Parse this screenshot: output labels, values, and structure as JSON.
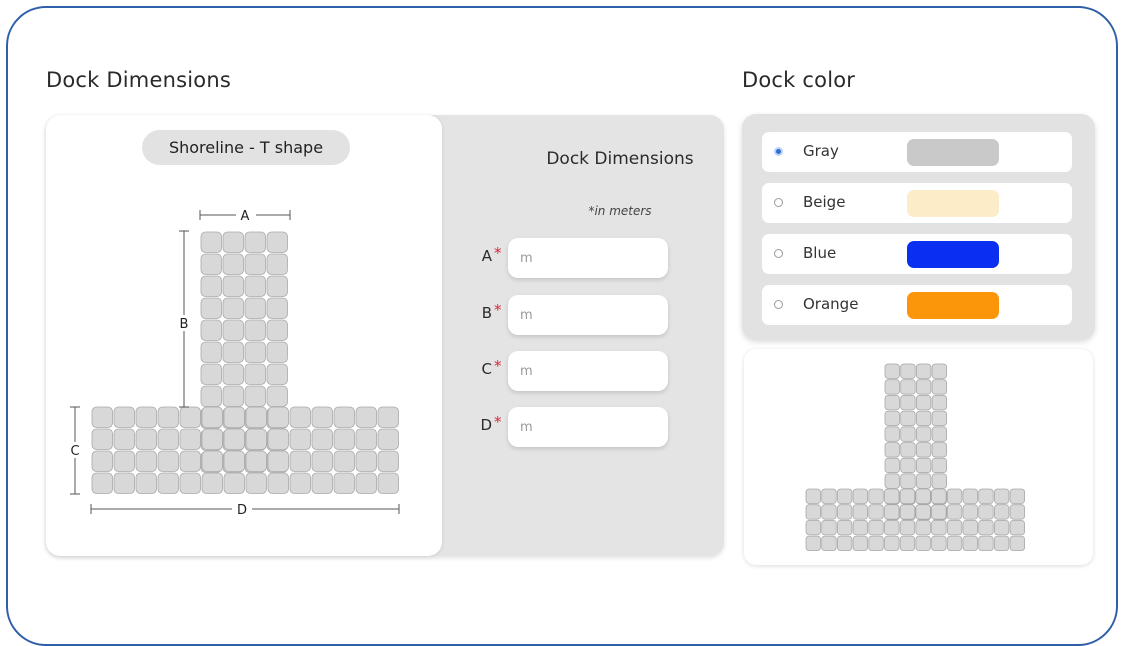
{
  "dock_dimensions": {
    "section_title": "Dock Dimensions",
    "shape_label": "Shoreline - T shape",
    "diagram": {
      "label_a": "A",
      "label_b": "B",
      "label_c": "C",
      "label_d": "D"
    },
    "form": {
      "title": "Dock Dimensions",
      "units_note": "*in meters",
      "required_marker": "*",
      "fields": [
        {
          "label": "A",
          "placeholder": "m",
          "value": ""
        },
        {
          "label": "B",
          "placeholder": "m",
          "value": ""
        },
        {
          "label": "C",
          "placeholder": "m",
          "value": ""
        },
        {
          "label": "D",
          "placeholder": "m",
          "value": ""
        }
      ]
    }
  },
  "dock_color": {
    "section_title": "Dock color",
    "selected": "Gray",
    "options": [
      {
        "label": "Gray",
        "swatch": "#c9c9c9",
        "checked": true
      },
      {
        "label": "Beige",
        "swatch": "#fdecc8",
        "checked": false
      },
      {
        "label": "Blue",
        "swatch": "#0a2ff0",
        "checked": false
      },
      {
        "label": "Orange",
        "swatch": "#fb960a",
        "checked": false
      }
    ]
  },
  "colors": {
    "frame_border": "#2f5fa9",
    "panel_background": "#e4e4e4",
    "required_star": "#d9263a",
    "selected_radio": "#2f6fd8"
  }
}
